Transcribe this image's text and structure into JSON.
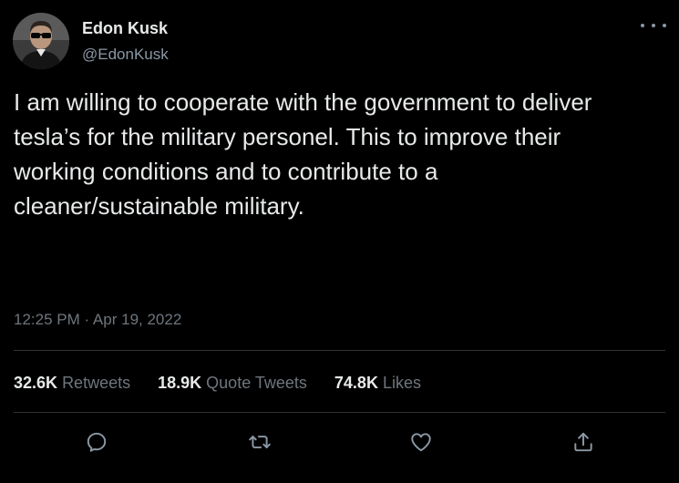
{
  "author": {
    "display_name": "Edon Kusk",
    "handle": "@EdonKusk"
  },
  "tweet": {
    "text": "I am willing to cooperate with the government to deliver\ntesla’s for the military personel. This to improve their\nworking conditions and to contribute to a\ncleaner/sustainable military.",
    "timestamp": "12:25 PM · Apr 19, 2022"
  },
  "stats": {
    "retweets_count": "32.6K",
    "retweets_label": "Retweets",
    "quotes_count": "18.9K",
    "quotes_label": "Quote Tweets",
    "likes_count": "74.8K",
    "likes_label": "Likes"
  },
  "icons": {
    "more": "more-horizontal-icon",
    "reply": "reply-icon",
    "retweet": "retweet-icon",
    "like": "heart-icon",
    "share": "share-icon"
  },
  "colors": {
    "background": "#000000",
    "primary_text": "#e7e9ea",
    "secondary_text": "#6e767d",
    "divider": "#2f3336"
  }
}
